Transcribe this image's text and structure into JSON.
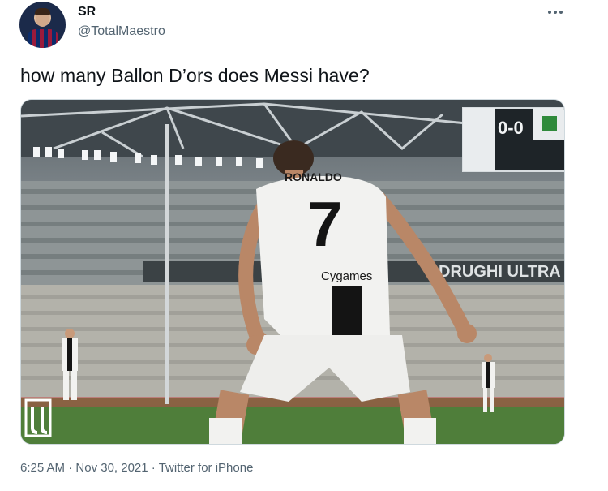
{
  "user": {
    "display_name": "SR",
    "handle": "@TotalMaestro",
    "avatar_icon": "profile-photo"
  },
  "tweet": {
    "text": "how many Ballon D’ors does Messi have?",
    "more_icon": "more-options-icon"
  },
  "media": {
    "jersey_name": "RONALDO",
    "jersey_number": "7",
    "sponsor": "Cygames",
    "banner_text": "DRUGHI ULTRA",
    "scoreboard": "0-0",
    "colors": {
      "jersey_white": "#f2f2f0",
      "jersey_black": "#141414",
      "pitch_green": "#4f7e3a"
    }
  },
  "meta": {
    "time": "6:25 AM",
    "separator1": " · ",
    "date": "Nov 30, 2021",
    "separator2": " · ",
    "source": "Twitter for iPhone"
  }
}
